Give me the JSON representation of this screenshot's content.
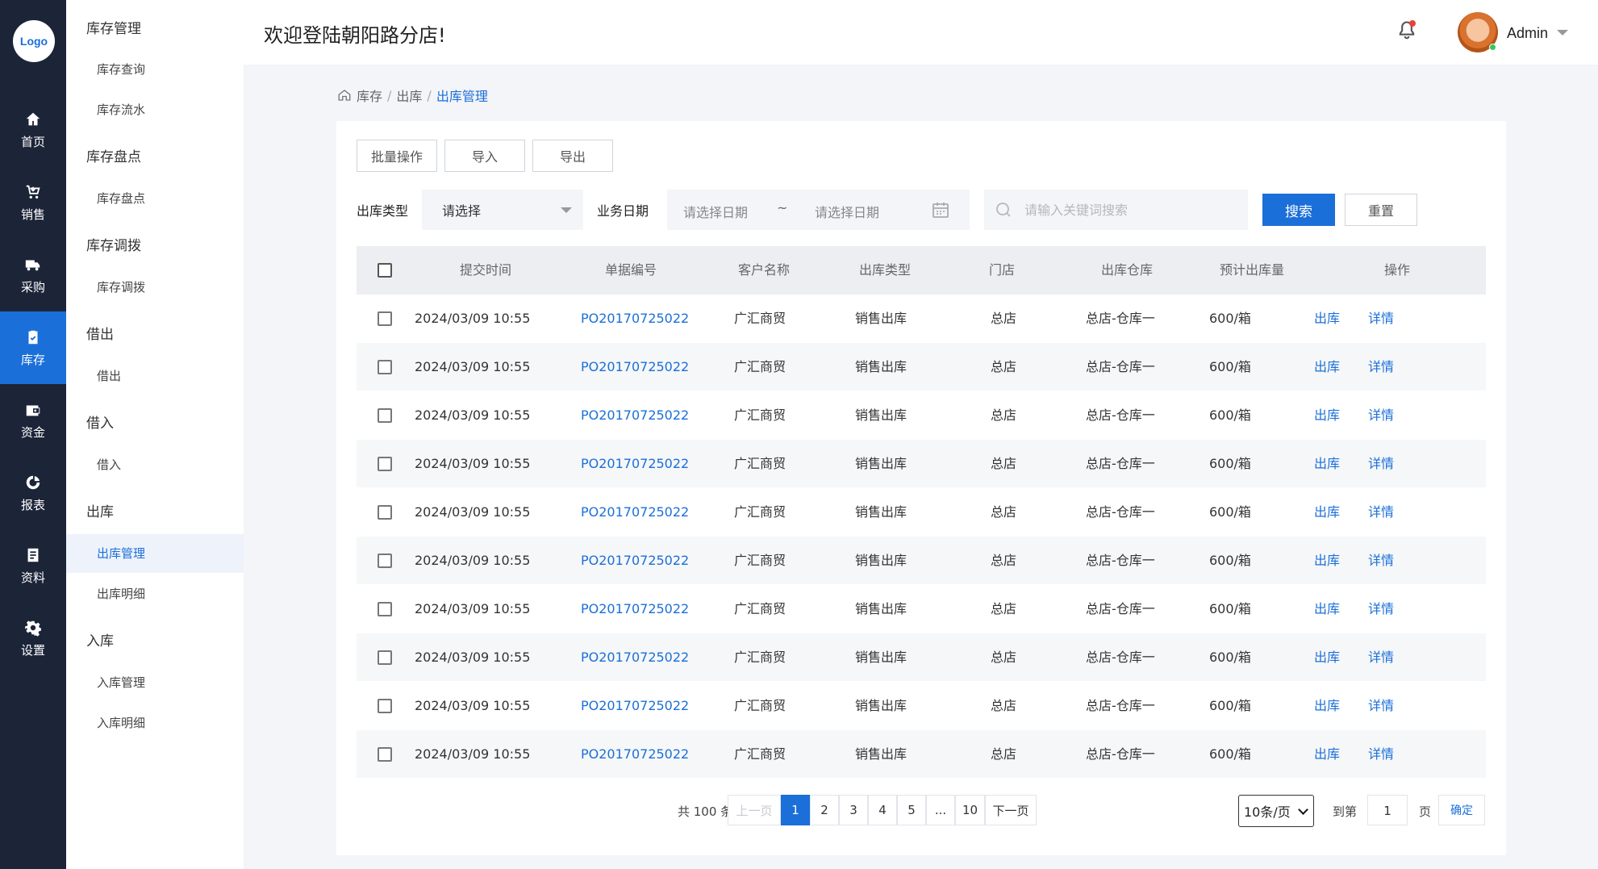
{
  "logo": "Logo",
  "rail": [
    {
      "label": "首页",
      "icon": "home-icon",
      "active": false
    },
    {
      "label": "销售",
      "icon": "cart-icon",
      "active": false
    },
    {
      "label": "采购",
      "icon": "truck-icon",
      "active": false
    },
    {
      "label": "库存",
      "icon": "clipboard-check-icon",
      "active": true
    },
    {
      "label": "资金",
      "icon": "wallet-icon",
      "active": false
    },
    {
      "label": "报表",
      "icon": "chart-ring-icon",
      "active": false
    },
    {
      "label": "资料",
      "icon": "document-icon",
      "active": false
    },
    {
      "label": "设置",
      "icon": "gear-icon",
      "active": false
    }
  ],
  "sidebar": {
    "groups": [
      {
        "title": "库存管理",
        "items": [
          "库存查询",
          "库存流水"
        ]
      },
      {
        "title": "库存盘点",
        "items": [
          "库存盘点"
        ]
      },
      {
        "title": "库存调拨",
        "items": [
          "库存调拨"
        ]
      },
      {
        "title": "借出",
        "items": [
          "借出"
        ]
      },
      {
        "title": "借入",
        "items": [
          "借入"
        ]
      },
      {
        "title": "出库",
        "items": [
          "出库管理",
          "出库明细"
        ]
      },
      {
        "title": "入库",
        "items": [
          "入库管理",
          "入库明细"
        ]
      }
    ],
    "active_item": "出库管理"
  },
  "header": {
    "welcome": "欢迎登陆朝阳路分店!",
    "user": "Admin",
    "notification_dot": true
  },
  "breadcrumb": [
    "库存",
    "出库",
    "出库管理"
  ],
  "toolbar": {
    "batch": "批量操作",
    "import": "导入",
    "export": "导出"
  },
  "filters": {
    "type_label": "出库类型",
    "type_value": "请选择",
    "date_label": "业务日期",
    "date_start": "请选择日期",
    "date_sep": "~",
    "date_end": "请选择日期",
    "search_placeholder": "请输入关键词搜索",
    "search_btn": "搜索",
    "reset_btn": "重置"
  },
  "table": {
    "columns": [
      "提交时间",
      "单据编号",
      "客户名称",
      "出库类型",
      "门店",
      "出库仓库",
      "预计出库量",
      "操作"
    ],
    "rows": [
      {
        "time": "2024/03/09 10:55",
        "no": "PO20170725022",
        "customer": "广汇商贸",
        "type": "销售出库",
        "store": "总店",
        "warehouse": "总店-仓库一",
        "qty": "600/箱",
        "op1": "出库",
        "op2": "详情"
      },
      {
        "time": "2024/03/09 10:55",
        "no": "PO20170725022",
        "customer": "广汇商贸",
        "type": "销售出库",
        "store": "总店",
        "warehouse": "总店-仓库一",
        "qty": "600/箱",
        "op1": "出库",
        "op2": "详情"
      },
      {
        "time": "2024/03/09 10:55",
        "no": "PO20170725022",
        "customer": "广汇商贸",
        "type": "销售出库",
        "store": "总店",
        "warehouse": "总店-仓库一",
        "qty": "600/箱",
        "op1": "出库",
        "op2": "详情"
      },
      {
        "time": "2024/03/09 10:55",
        "no": "PO20170725022",
        "customer": "广汇商贸",
        "type": "销售出库",
        "store": "总店",
        "warehouse": "总店-仓库一",
        "qty": "600/箱",
        "op1": "出库",
        "op2": "详情"
      },
      {
        "time": "2024/03/09 10:55",
        "no": "PO20170725022",
        "customer": "广汇商贸",
        "type": "销售出库",
        "store": "总店",
        "warehouse": "总店-仓库一",
        "qty": "600/箱",
        "op1": "出库",
        "op2": "详情"
      },
      {
        "time": "2024/03/09 10:55",
        "no": "PO20170725022",
        "customer": "广汇商贸",
        "type": "销售出库",
        "store": "总店",
        "warehouse": "总店-仓库一",
        "qty": "600/箱",
        "op1": "出库",
        "op2": "详情"
      },
      {
        "time": "2024/03/09 10:55",
        "no": "PO20170725022",
        "customer": "广汇商贸",
        "type": "销售出库",
        "store": "总店",
        "warehouse": "总店-仓库一",
        "qty": "600/箱",
        "op1": "出库",
        "op2": "详情"
      },
      {
        "time": "2024/03/09 10:55",
        "no": "PO20170725022",
        "customer": "广汇商贸",
        "type": "销售出库",
        "store": "总店",
        "warehouse": "总店-仓库一",
        "qty": "600/箱",
        "op1": "出库",
        "op2": "详情"
      },
      {
        "time": "2024/03/09 10:55",
        "no": "PO20170725022",
        "customer": "广汇商贸",
        "type": "销售出库",
        "store": "总店",
        "warehouse": "总店-仓库一",
        "qty": "600/箱",
        "op1": "出库",
        "op2": "详情"
      },
      {
        "time": "2024/03/09 10:55",
        "no": "PO20170725022",
        "customer": "广汇商贸",
        "type": "销售出库",
        "store": "总店",
        "warehouse": "总店-仓库一",
        "qty": "600/箱",
        "op1": "出库",
        "op2": "详情"
      }
    ]
  },
  "pagination": {
    "total": "共 100 条",
    "prev": "上一页",
    "pages": [
      "1",
      "2",
      "3",
      "4",
      "5",
      "...",
      "10"
    ],
    "current": "1",
    "next": "下一页",
    "page_size": "10条/页",
    "goto_label": "到第",
    "goto_value": "1",
    "page_unit": "页",
    "confirm": "确定"
  },
  "colors": {
    "primary": "#1b6fd8",
    "rail_bg": "#1c2438",
    "notify": "#e8423a"
  }
}
